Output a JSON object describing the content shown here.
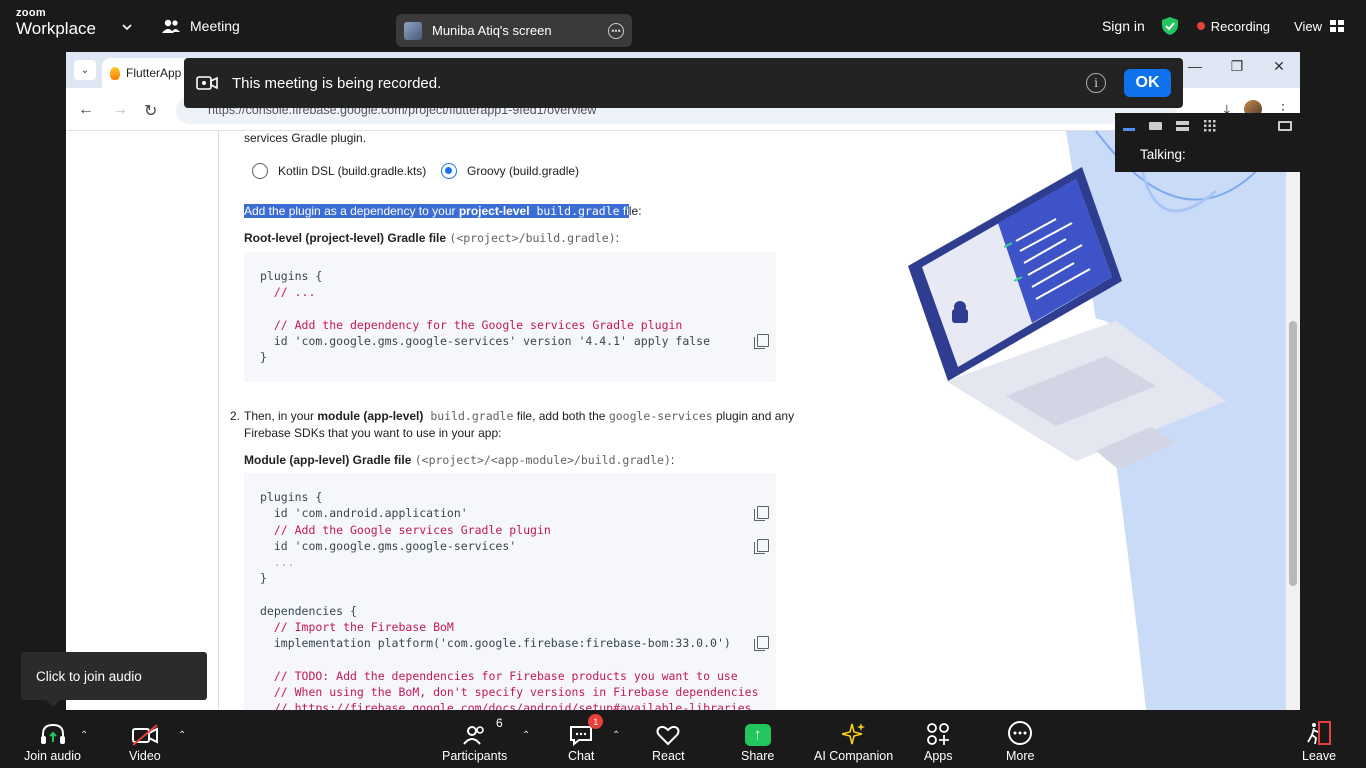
{
  "zoom": {
    "logo_top": "zoom",
    "logo_bottom": "Workplace",
    "meeting_label": "Meeting",
    "screen_pill": "Muniba Atiq's screen",
    "sign_in": "Sign in",
    "recording": "Recording",
    "view": "View"
  },
  "banner": {
    "message": "This meeting is being recorded.",
    "ok": "OK"
  },
  "video_panel": {
    "talking": "Talking:"
  },
  "browser": {
    "tab_title": "FlutterApp",
    "url": "https://console.firebase.google.com/project/flutterapp1-9fed1/overview"
  },
  "doc": {
    "intro_tail": "services Gradle plugin.",
    "radio_kotlin": "Kotlin DSL (build.gradle.kts)",
    "radio_groovy": "Groovy (build.gradle)",
    "radio_selected": "groovy",
    "step1_sel_a": "Add the plugin as a dependency to your ",
    "step1_sel_b": "project-level",
    "step1_sel_c": " build.gradle",
    "step1_sel_d": " fi",
    "step1_rest": "le:",
    "root_label": "Root-level (project-level) Gradle file",
    "root_path": "(<project>/build.gradle)",
    "root_colon": ":",
    "code1": [
      "plugins {",
      "  // ...",
      "",
      "  // Add the dependency for the Google services Gradle plugin",
      "  id 'com.google.gms.google-services' version '4.4.1' apply false",
      "}"
    ],
    "step2_num": "2.",
    "step2_a": "Then, in your ",
    "step2_b": "module (app-level)",
    "step2_c": " build.gradle",
    "step2_d": " file, add both the ",
    "step2_e": "google-services",
    "step2_f": " plugin and any",
    "step2_line2": "Firebase SDKs that you want to use in your app:",
    "module_label": "Module (app-level) Gradle file",
    "module_path": "(<project>/<app-module>/build.gradle)",
    "module_colon": ":",
    "code2": [
      "plugins {",
      "  id 'com.android.application'",
      "  // Add the Google services Gradle plugin",
      "  id 'com.google.gms.google-services'",
      "  ...",
      "}",
      "",
      "dependencies {",
      "  // Import the Firebase BoM",
      "  implementation platform('com.google.firebase:firebase-bom:33.0.0')",
      "",
      "  // TODO: Add the dependencies for Firebase products you want to use",
      "  // When using the BoM, don't specify versions in Firebase dependencies",
      "  // https://firebase.google.com/docs/android/setup#available-libraries"
    ]
  },
  "tooltip": "Click to join audio",
  "toolbar": {
    "join_audio": "Join audio",
    "video": "Video",
    "participants": "Participants",
    "participants_count": "6",
    "chat": "Chat",
    "chat_badge": "1",
    "react": "React",
    "share": "Share",
    "ai_companion": "AI Companion",
    "apps": "Apps",
    "more": "More",
    "leave": "Leave"
  },
  "colors": {
    "zoom_bg": "#1a1a1a",
    "zoom_blue": "#0e72ed",
    "recording_red": "#e8403a",
    "share_green": "#22c55e",
    "selection": "#3b6dd4",
    "code_comment": "#c2185b"
  }
}
